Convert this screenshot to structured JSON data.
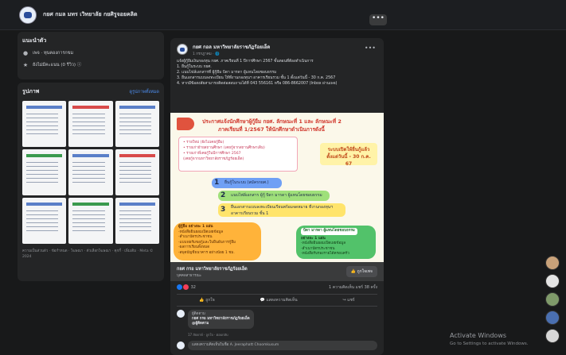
{
  "topbar": {
    "page_name": "กยศ กมล มทร เวิทยาลัย กยศิรูจอยคลิด",
    "more_label": "•••"
  },
  "left": {
    "intro_title": "แนะนำตัว",
    "intro_rows": [
      {
        "icon": "info-icon",
        "text": "เพจ · ทุนคองการกขม"
      },
      {
        "icon": "star-icon",
        "text": "ยังไม่มีคะแนน (0 รีวิว) ⓘ"
      }
    ],
    "photos_title": "รูปภาพ",
    "photos_see_all": "ดูรูปภาพทั้งหมด",
    "footer": "ความเป็นส่วนตัว · ข้อกำหนด · โฆษณา · ตัวเลือกโฆษณา · คุกกี้ · เพิ่มเติม · Meta © 2024"
  },
  "post": {
    "author": "กยศ กอล มหาวิทยาลัยราชภัฏร้อยเอ็ด",
    "meta": "1 กรกฎาคม · 🌐",
    "more": "•••",
    "text_lines": [
      "แจ้งผู้กู้ยืมเงินกองทุน กยศ. ภาคเรียนที่ 1 ปีการศึกษา 2567 ขั้นตอนที่ต้องดำเนินการ",
      "1. ยื่นกู้ในระบบ กยศ.",
      "2. แนบไฟล์เอกสารที่ ผู้กู้ยืม บิดา มารดา ผู้แทนโดยชอบธรรม",
      "3. ยื่นเอกสารแบบลงทะเบียน ให้ที่งานกองทุนฯ อาคารเรียนรวม ชั้น 1 ตั้งแต่วันนี้ - 30 ก.ค. 2567",
      "4. หากมีข้อสงสัยสามารถติดต่อสอบถามได้ที่ 043 556161 หรือ 086-8662007 (Inbox ผ่านเพจ)"
    ]
  },
  "poster": {
    "head1": "ประกาศแจ้งนักศึกษาผู้กู้ยืม กยศ. ลักษณะที่ 1 และ ลักษณะที่ 2",
    "head2": "ภาคเรียนที่ 1/2567 ให้นักศึกษาดำเนินการดังนี้",
    "pink_lines": [
      "• รายใหม่ (ยังไม่เคยกู้ยืม)",
      "• รายเก่าย้ายสถานศึกษา (เคยกู้จากสถานศึกษาเดิม)",
      "• รายเก่าที่เคยกู้ในปีการศึกษา 2567",
      "(เคยกู้จากมหาวิทยาลัยราชภัฏร้อยเอ็ด)"
    ],
    "date_lines": [
      "ระบบเปิดให้ยื่นกู้แล้ว",
      "ตั้งแต่วันนี้ - 30 ก.ค. 67"
    ],
    "steps": [
      {
        "num": "1",
        "text": "ยื่นกู้ในระบบ (สมัครกยศ.)"
      },
      {
        "num": "2",
        "text": "แนบไฟล์เอกสาร ผู้กู้ บิดา มารดา ผู้แทนโดยชอบธรรม"
      },
      {
        "num": "3",
        "text": "ยื่นเอกสารแบบลงทะเบียนเรียนพร้อมจดหมาย ที่งานกองทุนฯ อาคารเรียนรวม ชั้น 1"
      }
    ],
    "orange_title": "ผู้กู้ยืม อย่างละ 1 แผ่น",
    "orange_lines": [
      "-หนังสือยินยอมเปิดเผยข้อมูล",
      "-สำเนาบัตรประชาชน",
      "-แบบฟอร์มขอกู้และใบยืนยันการกู้ยืม",
      "-ผลการเรียนทั้งหมด",
      "-สมุดบัญชีธนาคาร อย่างน้อย 1 ชม."
    ],
    "green_title": "บิดา มารดา ผู้แทนโดยชอบธรรม",
    "green_sub": "อย่างละ 1 แผ่น",
    "green_lines": [
      "-หนังสือยินยอมเปิดเผยข้อมูล",
      "-สำเนาบัตรประชาชน",
      "-หนังสือรับรองรายได้ครอบครัว"
    ]
  },
  "page_strip": {
    "name": "กยศ กรอ มหาวิทยาลัยราชภัฏร้อยเอ็ด",
    "sub": "บุคคลสาธารณะ",
    "like_label": "ถูกใจเพจ"
  },
  "stats": {
    "reactions": "32",
    "comments": "1 ความคิดเห็น",
    "shares": "แชร์ 38 ครั้ง"
  },
  "actions": {
    "like": "ถูกใจ",
    "comment": "แสดงความคิดเห็น",
    "share": "แชร์"
  },
  "comment": {
    "author": "ผู้ติดตาม",
    "text_lines": [
      "กยศ กรอ มหาวิทยาลัยราชภัฏร้อยเอ็ด",
      "@ผู้ติดตาม"
    ],
    "meta": "17 สัปดาห์ · ถูกใจ · ตอบกลับ"
  },
  "write": {
    "placeholder": "แสดงความคิดเห็นในชื่อ A. Jeeraphatt Choomkusum"
  },
  "watermark": {
    "line1": "Activate Windows",
    "line2": "Go to Settings to activate Windows."
  }
}
